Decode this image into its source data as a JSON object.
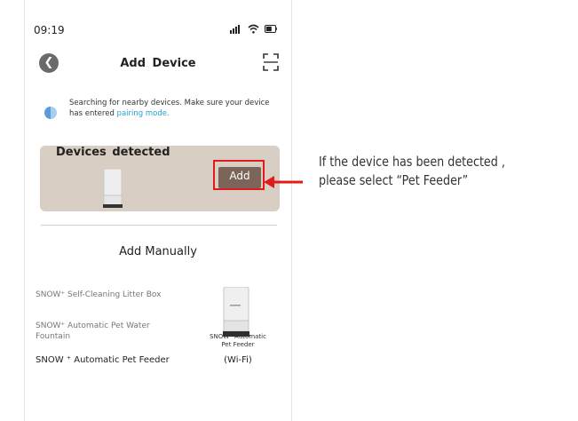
{
  "status_bar": {
    "time": "09:19"
  },
  "header": {
    "title": "Add  Device"
  },
  "search": {
    "text": "Searching for nearby devices. Make sure your device has entered ",
    "link": "pairing mode."
  },
  "detected": {
    "title": "Devices  detected",
    "add_label": "Add"
  },
  "manual": {
    "title": "Add Manually",
    "categories": [
      "SNOW⁺ Self-Cleaning Litter Box",
      "SNOW⁺ Automatic Pet Water Fountain",
      "SNOW ⁺ Automatic Pet Feeder"
    ],
    "device": {
      "caption_line1": "SNOW⁺ Automatic",
      "caption_line2": "Pet Feeder",
      "wifi": "(Wi-Fi)"
    }
  },
  "annotation": {
    "line1": "If the device has been detected ,",
    "line2": "please select “Pet Feeder”",
    "highlight_color": "#e21a1a"
  }
}
